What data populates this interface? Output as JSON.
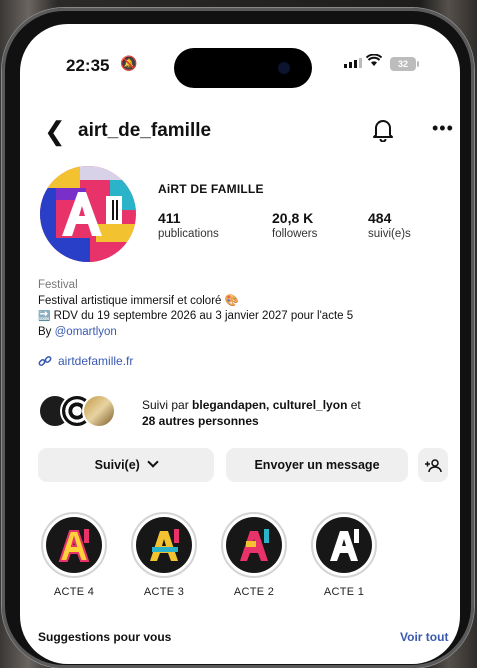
{
  "status_bar": {
    "time": "22:35",
    "battery": "32"
  },
  "header": {
    "username": "airt_de_famille"
  },
  "profile": {
    "display_name": "AiRT DE FAMILLE",
    "stats": [
      {
        "value": "411",
        "label": "publications"
      },
      {
        "value": "20,8 K",
        "label": "followers"
      },
      {
        "value": "484",
        "label": "suivi(e)s"
      }
    ]
  },
  "bio": {
    "category": "Festival",
    "line1": "Festival artistique immersif et coloré 🎨",
    "line2": "RDV du 19 septembre 2026 au 3 janvier 2027 pour l'acte 5",
    "by_prefix": "By ",
    "mention": "@omartlyon",
    "link": "airtdefamille.fr"
  },
  "followed_by": {
    "prefix": "Suivi par ",
    "names": "blegandapen, culturel_lyon",
    "middle": " et ",
    "others": "28 autres personnes"
  },
  "actions": {
    "following_label": "Suivi(e)",
    "message_label": "Envoyer un message"
  },
  "highlights": [
    {
      "label": "ACTE 4"
    },
    {
      "label": "ACTE 3"
    },
    {
      "label": "ACTE 2"
    },
    {
      "label": "ACTE 1"
    }
  ],
  "suggestions": {
    "title": "Suggestions pour vous",
    "see_all": "Voir tout"
  },
  "colors": {
    "link": "#3a5ab0",
    "button_bg": "#efefef"
  }
}
